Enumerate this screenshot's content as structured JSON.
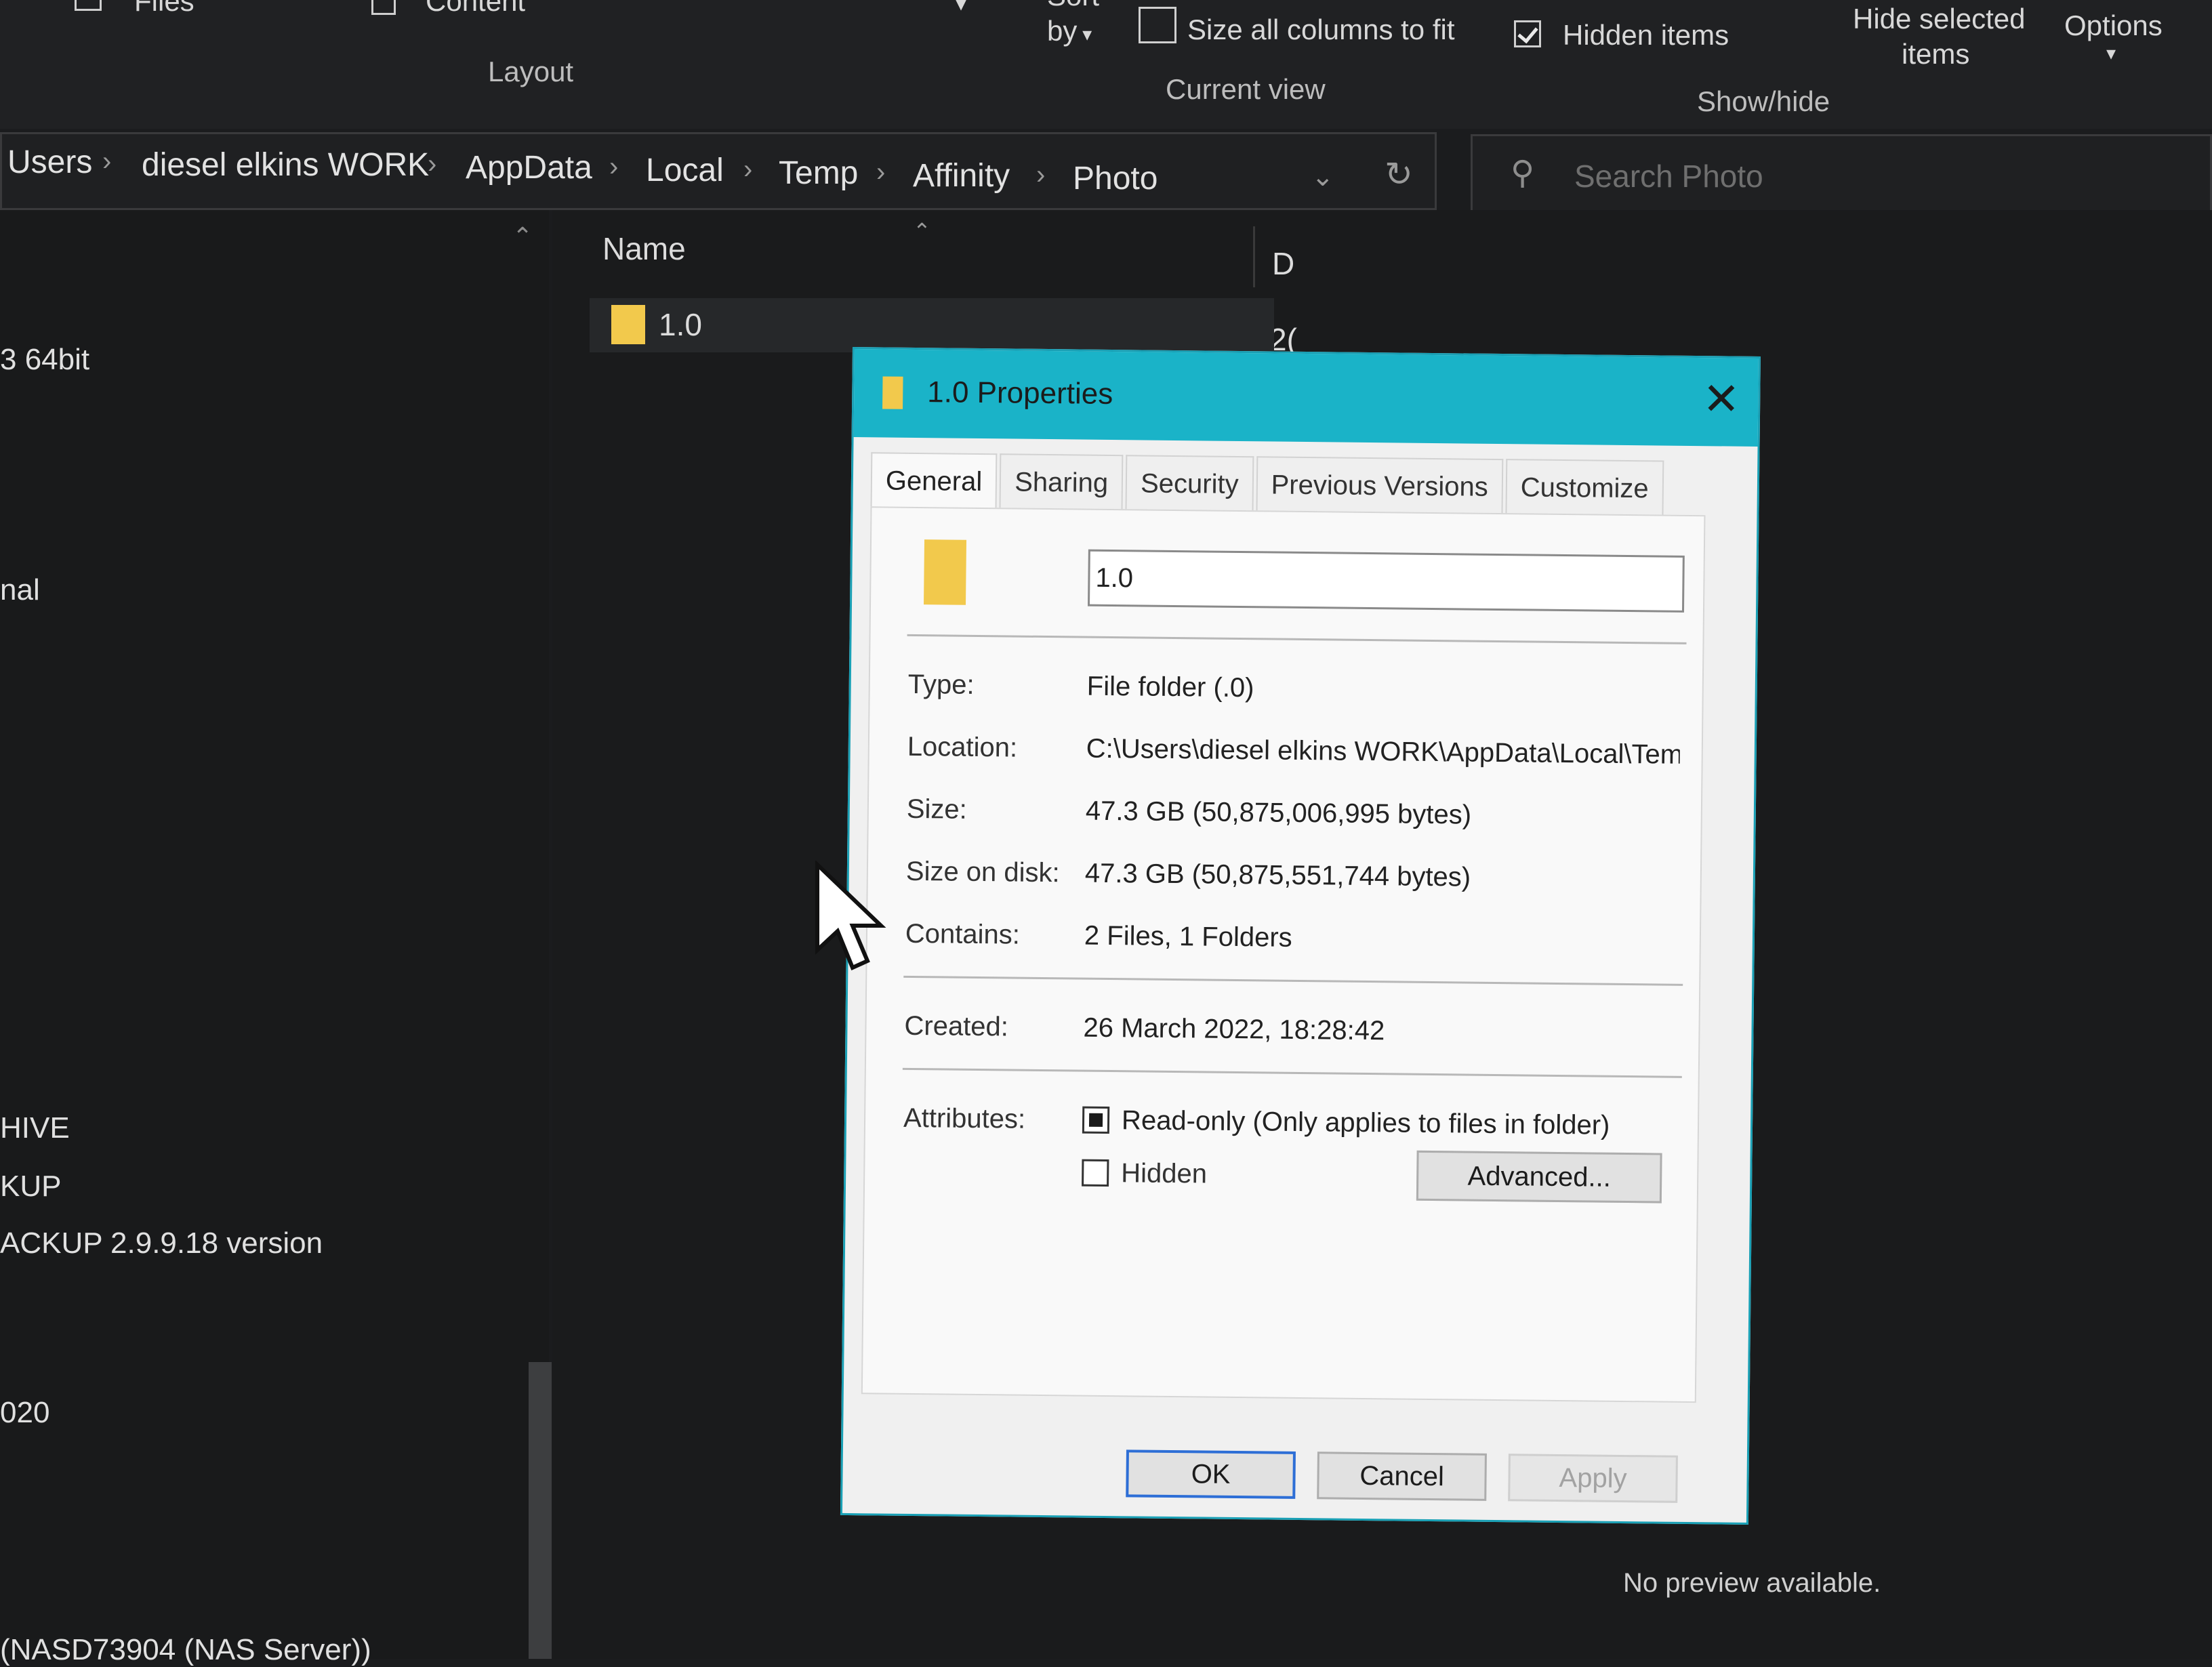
{
  "ribbon": {
    "files_label": "Files",
    "content_label": "Content",
    "layout_label": "Layout",
    "sort_label": "Sort",
    "sort_by_label": "by",
    "size_columns_label": "Size all columns to fit",
    "current_view_label": "Current view",
    "hidden_items_label": "Hidden items",
    "hidden_items_checked": true,
    "hide_selected_label_1": "Hide selected",
    "hide_selected_label_2": "items",
    "options_label": "Options",
    "show_hide_label": "Show/hide"
  },
  "breadcrumb": [
    "Users",
    "diesel elkins WORK",
    "AppData",
    "Local",
    "Temp",
    "Affinity",
    "Photo"
  ],
  "search": {
    "placeholder": "Search Photo"
  },
  "navigation": {
    "items": [
      "3 64bit",
      "nal",
      "HIVE",
      "KUP",
      "ACKUP 2.9.9.18 version",
      "020",
      "(NASD73904 (NAS Server))"
    ]
  },
  "file_list": {
    "columns": [
      "Name",
      "D"
    ],
    "rows": [
      {
        "name": "1.0",
        "date": "2("
      }
    ],
    "preview_text": "No preview available."
  },
  "dialog": {
    "title": "1.0 Properties",
    "tabs": [
      "General",
      "Sharing",
      "Security",
      "Previous Versions",
      "Customize"
    ],
    "active_tab": "General",
    "folder_name": "1.0",
    "fields": {
      "type_label": "Type:",
      "type_value": "File folder (.0)",
      "location_label": "Location:",
      "location_value": "C:\\Users\\diesel elkins WORK\\AppData\\Local\\Temp",
      "size_label": "Size:",
      "size_value": "47.3 GB (50,875,006,995 bytes)",
      "size_on_disk_label": "Size on disk:",
      "size_on_disk_value": "47.3 GB (50,875,551,744 bytes)",
      "contains_label": "Contains:",
      "contains_value": "2 Files, 1 Folders",
      "created_label": "Created:",
      "created_value": "26 March 2022, 18:28:42",
      "attributes_label": "Attributes:",
      "readonly_label": "Read-only (Only applies to files in folder)",
      "hidden_label": "Hidden"
    },
    "buttons": {
      "advanced": "Advanced...",
      "ok": "OK",
      "cancel": "Cancel",
      "apply": "Apply"
    }
  }
}
